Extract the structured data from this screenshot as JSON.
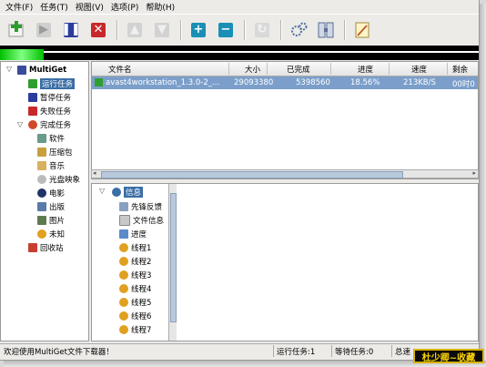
{
  "menu": [
    "文件(F)",
    "任务(T)",
    "视图(V)",
    "选项(P)",
    "帮助(H)"
  ],
  "colors": {
    "accent": "#3a6ea5",
    "row_selected": "#7b9fca",
    "speed_green": "#00c000",
    "stamp_border": "#d7b200"
  },
  "toolbar": {
    "icons": [
      "add-task-icon",
      "start-icon",
      "pause-icon",
      "delete-icon",
      "move-up-icon",
      "move-down-icon",
      "add-icon",
      "remove-icon",
      "refresh-icon",
      "settings-icon",
      "properties-icon",
      "notes-icon"
    ]
  },
  "tree": {
    "root": "MultiGet",
    "items": [
      "运行任务",
      "暂停任务",
      "失败任务",
      "完成任务",
      "软件",
      "压缩包",
      "音乐",
      "光盘映象",
      "电影",
      "出版",
      "图片",
      "未知",
      "回收站"
    ]
  },
  "list": {
    "columns": [
      "文件名",
      "大小",
      "已完成",
      "进度",
      "速度",
      "剩余"
    ],
    "rows": [
      {
        "name": "avast4workstation_1.3.0-2_...",
        "size": "29093380",
        "done": "5398560",
        "progress": "18.56%",
        "speed": "213KB/S",
        "remaining": "00时0"
      }
    ]
  },
  "detail": {
    "root": "信息",
    "items": [
      "先锋反馈",
      "文件信息",
      "进度",
      "线程1",
      "线程2",
      "线程3",
      "线程4",
      "线程5",
      "线程6",
      "线程7"
    ]
  },
  "status": {
    "message": "欢迎使用MultiGet文件下载器！",
    "running": "运行任务:1",
    "waiting": "等待任务:0",
    "total": "总速"
  },
  "watermark": "杜少卿~收藏"
}
